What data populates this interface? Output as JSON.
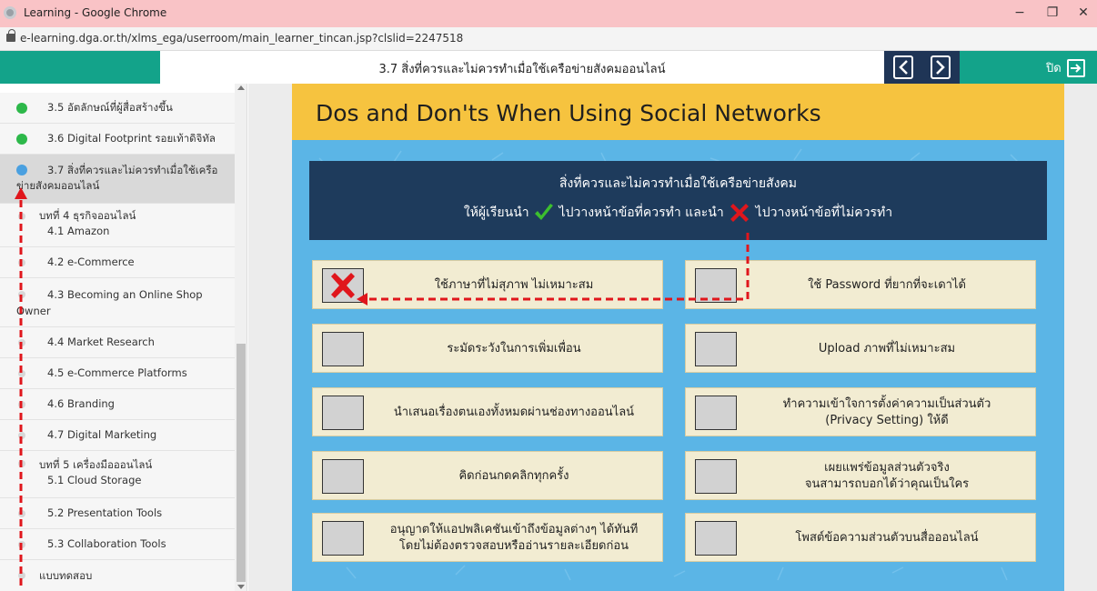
{
  "browser": {
    "window_title": "Learning - Google Chrome",
    "url": "e-learning.dga.or.th/xlms_ega/userroom/main_learner_tincan.jsp?clslid=2247518",
    "minimize": "−",
    "restore": "❐",
    "close": "✕"
  },
  "header": {
    "lesson_title": "3.7 สิ่งที่ควรและไม่ควรทำเมื่อใช้เครือข่ายสังคมออนไลน์",
    "close_label": "ปิด"
  },
  "sidebar": {
    "items": [
      {
        "label": "3.5 อัตลักษณ์ที่ผู้สื่อสร้างขึ้น",
        "status": "done"
      },
      {
        "label": "3.6 Digital Footprint รอยเท้าดิจิทัล",
        "status": "done"
      },
      {
        "label": "3.7 สิ่งที่ควรและไม่ควรทำเมื่อใช้เครือ",
        "label2": "ข่ายสังคมออนไลน์",
        "status": "current"
      },
      {
        "label": "บทที่ 4 ธุรกิจออนไลน์",
        "label2": "4.1 Amazon",
        "status": "pending"
      },
      {
        "label": "4.2 e-Commerce",
        "status": "pending"
      },
      {
        "label": "4.3 Becoming an Online Shop",
        "label2": "Owner",
        "status": "pending"
      },
      {
        "label": "4.4 Market Research",
        "status": "pending"
      },
      {
        "label": "4.5 e-Commerce Platforms",
        "status": "pending"
      },
      {
        "label": "4.6 Branding",
        "status": "pending"
      },
      {
        "label": "4.7 Digital Marketing",
        "status": "pending"
      },
      {
        "label": "บทที่ 5 เครื่องมือออนไลน์",
        "label2": "5.1 Cloud Storage",
        "status": "pending"
      },
      {
        "label": "5.2 Presentation Tools",
        "status": "pending"
      },
      {
        "label": "5.3 Collaboration Tools",
        "status": "pending"
      },
      {
        "label": "แบบทดสอบ",
        "status": "pending"
      }
    ]
  },
  "slide": {
    "title": "Dos and Don'ts When Using Social Networks",
    "instruction_line1": "สิ่งที่ควรและไม่ควรทำเมื่อใช้เครือข่ายสังคม",
    "instruction_part1": "ให้ผู้เรียนนำ",
    "instruction_part2": "ไปวางหน้าข้อที่ควรทำ และนำ",
    "instruction_part3": "ไปวางหน้าข้อที่ไม่ควรทำ",
    "cards_left": [
      {
        "text": "ใช้ภาษาที่ไม่สุภาพ ไม่เหมาะสม",
        "mark": "x"
      },
      {
        "text": "ระมัดระวังในการเพิ่มเพื่อน",
        "mark": ""
      },
      {
        "text": "นำเสนอเรื่องตนเองทั้งหมดผ่านช่องทางออนไลน์",
        "mark": ""
      },
      {
        "text": "คิดก่อนกดคลิกทุกครั้ง",
        "mark": ""
      },
      {
        "text": "อนุญาตให้แอปพลิเคชันเข้าถึงข้อมูลต่างๆ ได้ทันที",
        "text2": "โดยไม่ต้องตรวจสอบหรืออ่านรายละเอียดก่อน",
        "mark": ""
      }
    ],
    "cards_right": [
      {
        "text": "ใช้ Password ที่ยากที่จะเดาได้",
        "mark": ""
      },
      {
        "text": "Upload ภาพที่ไม่เหมาะสม",
        "mark": ""
      },
      {
        "text": "ทำความเข้าใจการตั้งค่าความเป็นส่วนตัว",
        "text2": "(Privacy Setting) ให้ดี",
        "mark": ""
      },
      {
        "text": "เผยแพร่ข้อมูลส่วนตัวจริง",
        "text2": "จนสามารถบอกได้ว่าคุณเป็นใคร",
        "mark": ""
      },
      {
        "text": "โพสต์ข้อความส่วนตัวบนสื่อออนไลน์",
        "mark": ""
      }
    ]
  },
  "colors": {
    "header_green": "#13a38a",
    "nav_navy": "#1e3b5c",
    "slide_blue": "#5bb5e6",
    "title_yellow": "#f6c33f",
    "card_beige": "#f2ecd2",
    "annotation_red": "#e0161c",
    "done_green": "#2db84a",
    "current_blue": "#4aa0e0"
  }
}
